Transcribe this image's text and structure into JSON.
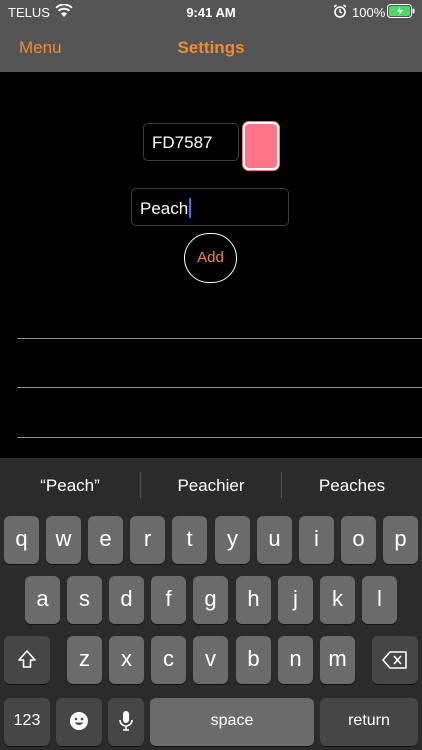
{
  "status_bar": {
    "carrier": "TELUS",
    "time": "9:41 AM",
    "battery_percent": "100%"
  },
  "nav": {
    "left_label": "Menu",
    "title": "Settings"
  },
  "form": {
    "hex_value": "FD7587",
    "swatch_color": "#FD7587",
    "name_value": "Peach",
    "add_label": "Add"
  },
  "keyboard": {
    "suggestions": [
      "“Peach”",
      "Peachier",
      "Peaches"
    ],
    "row1": [
      "q",
      "w",
      "e",
      "r",
      "t",
      "y",
      "u",
      "i",
      "o",
      "p"
    ],
    "row2": [
      "a",
      "s",
      "d",
      "f",
      "g",
      "h",
      "j",
      "k",
      "l"
    ],
    "row3": [
      "z",
      "x",
      "c",
      "v",
      "b",
      "n",
      "m"
    ],
    "numbers_label": "123",
    "space_label": "space",
    "return_label": "return"
  },
  "colors": {
    "accent": "#f28a2e",
    "nav_background": "#545454",
    "keyboard_background": "#2b2b2b"
  }
}
